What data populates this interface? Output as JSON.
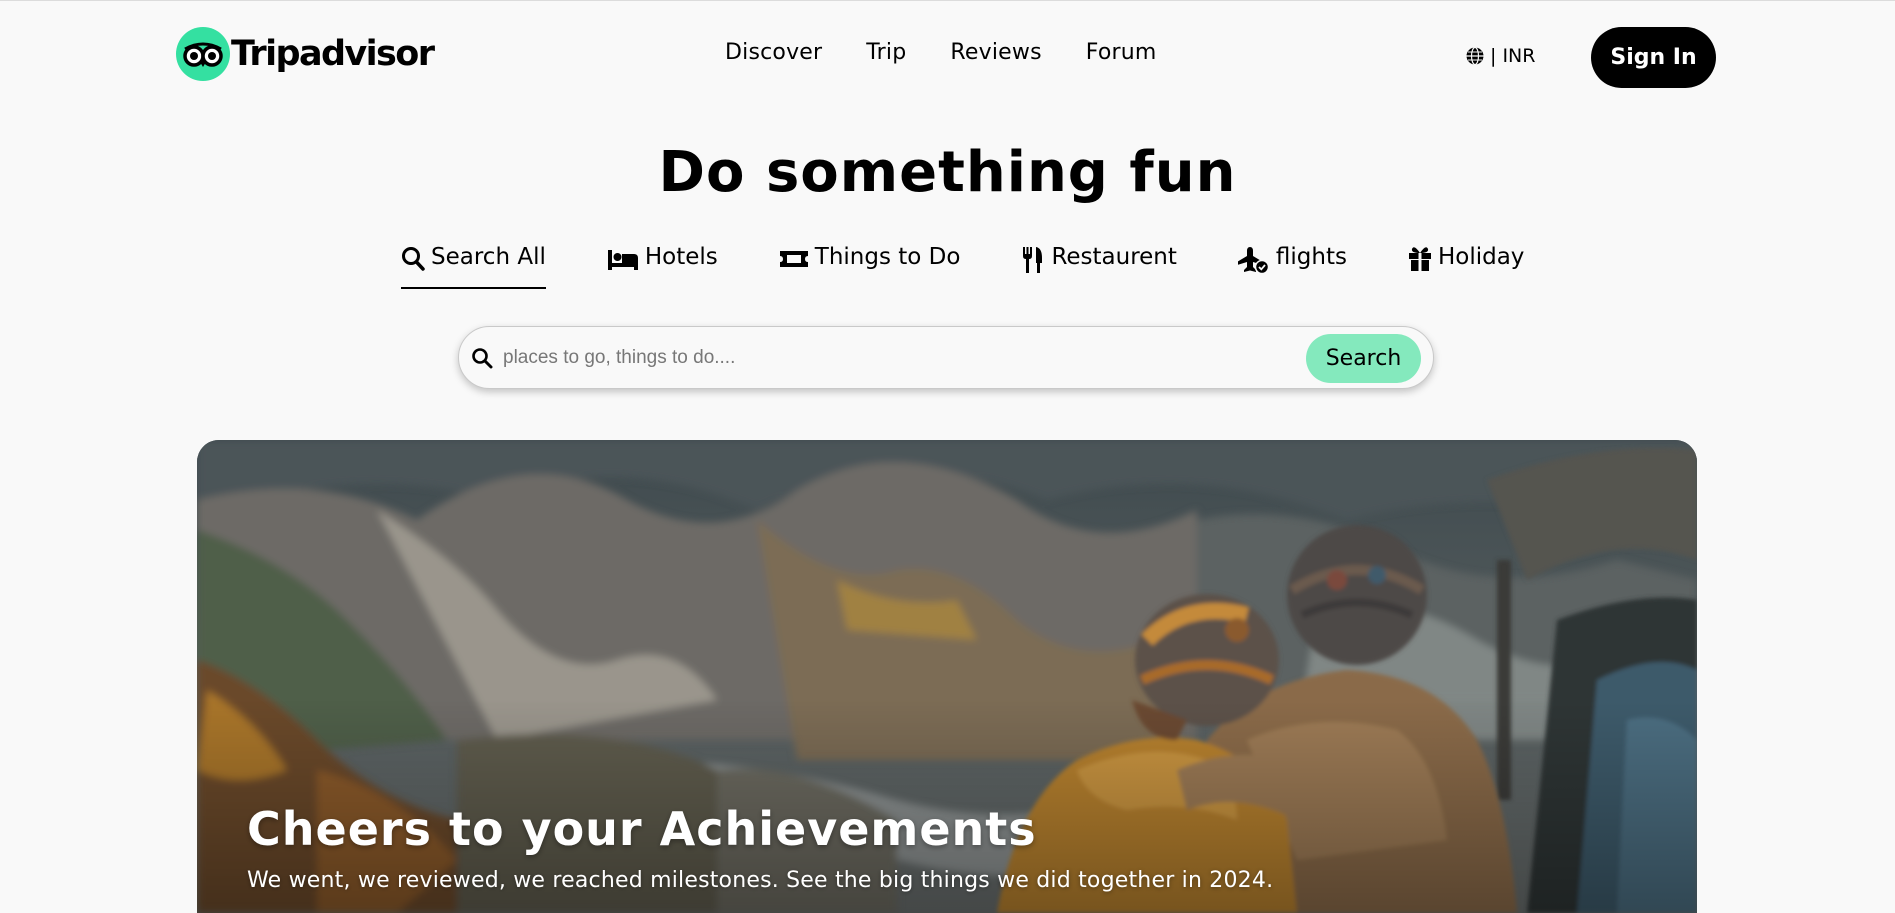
{
  "brand": {
    "name": "Tripadvisor",
    "accent": "#34e0a1"
  },
  "nav": [
    {
      "label": "Discover"
    },
    {
      "label": "Trip"
    },
    {
      "label": "Reviews"
    },
    {
      "label": "Forum"
    }
  ],
  "currency": {
    "icon": "globe-icon",
    "label": "| INR"
  },
  "signin": {
    "label": "Sign In"
  },
  "hero": {
    "title": "Do something fun"
  },
  "tabs": [
    {
      "label": "Search All",
      "icon": "search-icon",
      "active": true
    },
    {
      "label": "Hotels",
      "icon": "bed-icon"
    },
    {
      "label": "Things to Do",
      "icon": "ticket-icon"
    },
    {
      "label": "Restaurent",
      "icon": "utensils-icon"
    },
    {
      "label": "flights",
      "icon": "plane-check-icon"
    },
    {
      "label": "Holiday",
      "icon": "gift-icon"
    }
  ],
  "search": {
    "placeholder": "places to go, things to do....",
    "button_label": "Search",
    "button_color": "#84e9bd"
  },
  "banner": {
    "title": "Cheers to your Achievements",
    "subtitle": "We went, we reviewed, we reached milestones. See the big things we did together in 2024."
  }
}
